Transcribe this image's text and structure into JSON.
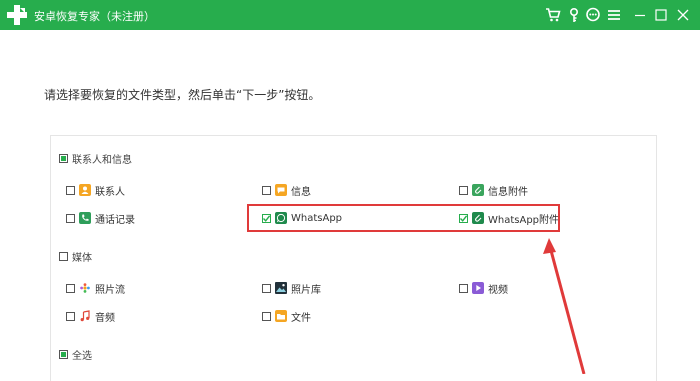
{
  "app": {
    "title": "安卓恢复专家（未注册）"
  },
  "instruction": "请选择要恢复的文件类型，然后单击“下一步”按钮。",
  "sections": {
    "contacts_info": {
      "label": "联系人和信息",
      "state": "partial"
    },
    "media": {
      "label": "媒体",
      "state": "unchecked"
    },
    "select_all": {
      "label": "全选",
      "state": "partial"
    }
  },
  "items": {
    "contacts": {
      "label": "联系人",
      "checked": false
    },
    "messages": {
      "label": "信息",
      "checked": false
    },
    "message_attachments": {
      "label": "信息附件",
      "checked": false
    },
    "call_log": {
      "label": "通话记录",
      "checked": false
    },
    "whatsapp": {
      "label": "WhatsApp",
      "checked": true
    },
    "whatsapp_attachments": {
      "label": "WhatsApp附件",
      "checked": true
    },
    "photo_stream": {
      "label": "照片流",
      "checked": false
    },
    "photo_library": {
      "label": "照片库",
      "checked": false
    },
    "video": {
      "label": "视频",
      "checked": false
    },
    "audio": {
      "label": "音频",
      "checked": false
    },
    "documents": {
      "label": "文件",
      "checked": false
    }
  },
  "icons": {
    "cart": "cart-icon",
    "key": "key-icon",
    "chat": "chat-icon",
    "menu": "menu-icon",
    "minimize": "minimize-icon",
    "maximize": "maximize-icon",
    "close": "close-icon"
  },
  "colors": {
    "brand": "#27ad4d",
    "highlight": "#e03a3a"
  }
}
